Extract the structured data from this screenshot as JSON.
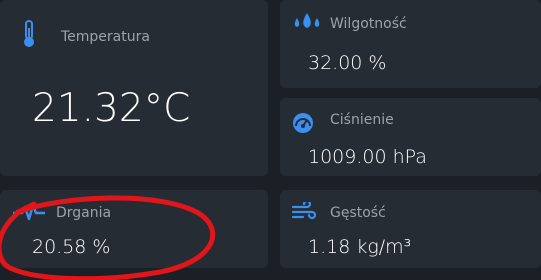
{
  "tiles": {
    "temperature": {
      "label": "Temperatura",
      "value": "21.32°C",
      "icon": "thermometer-icon"
    },
    "humidity": {
      "label": "Wilgotność",
      "value": "32.00 %",
      "icon": "water-drops-icon"
    },
    "pressure": {
      "label": "Ciśnienie",
      "value": "1009.00 hPa",
      "icon": "gauge-icon"
    },
    "vibration": {
      "label": "Drgania",
      "value": "20.58 %",
      "icon": "vibration-wave-icon"
    },
    "density": {
      "label": "Gęstość",
      "value": "1.18 kg/m³",
      "icon": "wind-icon"
    }
  },
  "colors": {
    "background": "#1b2026",
    "tile": "#262c33",
    "accent": "#3a8ff0",
    "label": "#9aa3ad",
    "annotation": "#e0161b"
  }
}
